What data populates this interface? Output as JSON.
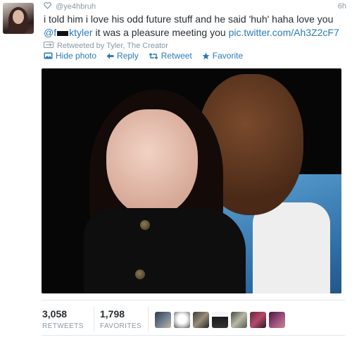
{
  "tweet": {
    "handle": "@ye4hbruh",
    "time": "6h",
    "text_part1": "i told him i love his odd future stuff and he said 'huh' haha love you ",
    "mention_prefix": "@f",
    "mention_suffix": "ktyler",
    "text_part2": " it was a pleasure meeting you ",
    "link": "pic.twitter.com/Ah3Z2cF7",
    "retweeted_by": "Retweeted by Tyler, The Creator"
  },
  "actions": {
    "hide_photo": "Hide photo",
    "reply": "Reply",
    "retweet": "Retweet",
    "favorite": "Favorite"
  },
  "stats": {
    "retweets_count": "3,058",
    "retweets_label": "RETWEETS",
    "favorites_count": "1,798",
    "favorites_label": "FAVORITES"
  },
  "icons": {
    "heart": "heart-icon",
    "retweet_small": "retweet-icon",
    "photo": "photo-icon",
    "reply": "reply-icon",
    "retweet": "retweet-icon",
    "favorite": "star-icon"
  },
  "colors": {
    "link": "#2b7bb9",
    "muted": "#8899a6",
    "text": "#292f33"
  }
}
